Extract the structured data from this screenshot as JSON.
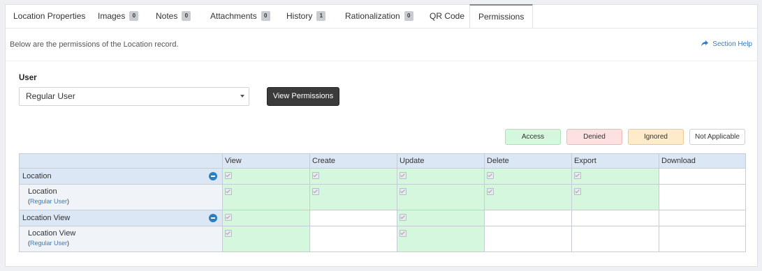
{
  "tabs": [
    {
      "label": "Location Properties"
    },
    {
      "label": "Images",
      "badge": "0"
    },
    {
      "label": "Notes",
      "badge": "0"
    },
    {
      "label": "Attachments",
      "badge": "0"
    },
    {
      "label": "History",
      "badge": "1"
    },
    {
      "label": "Rationalization",
      "badge": "0"
    },
    {
      "label": "QR Code"
    },
    {
      "label": "Permissions",
      "active": true
    }
  ],
  "description": "Below are the permissions of the Location record.",
  "section_help": "Section Help",
  "user_label": "User",
  "user_select": {
    "value": "Regular User"
  },
  "view_permissions_button": "View Permissions",
  "legend": {
    "access": "Access",
    "denied": "Denied",
    "ignored": "Ignored",
    "not_applicable": "Not Applicable"
  },
  "colors": {
    "access": "#d4f7dd",
    "denied": "#fde0e0",
    "ignored": "#fdebc9",
    "header": "#dce7f6",
    "link": "#3a7bbf"
  },
  "table": {
    "columns": [
      "",
      "View",
      "Create",
      "Update",
      "Delete",
      "Export",
      "Download"
    ],
    "rows": [
      {
        "label": "Location",
        "group": true,
        "cells": [
          "access-checked",
          "access-checked",
          "access-checked",
          "access-checked",
          "access-checked",
          "na"
        ]
      },
      {
        "label": "Location",
        "sub_prefix": "(",
        "sub_link": "Regular User",
        "sub_suffix": ")",
        "cells": [
          "access-checked",
          "access-checked",
          "access-checked",
          "access-checked",
          "access-checked",
          "na"
        ]
      },
      {
        "label": "Location View",
        "group": true,
        "cells": [
          "access-checked",
          "na",
          "access-checked",
          "na",
          "na",
          "na"
        ]
      },
      {
        "label": "Location View",
        "sub_prefix": "(",
        "sub_link": "Regular User",
        "sub_suffix": ")",
        "cells": [
          "access-checked",
          "na",
          "access-checked",
          "na",
          "na",
          "na"
        ]
      }
    ]
  }
}
